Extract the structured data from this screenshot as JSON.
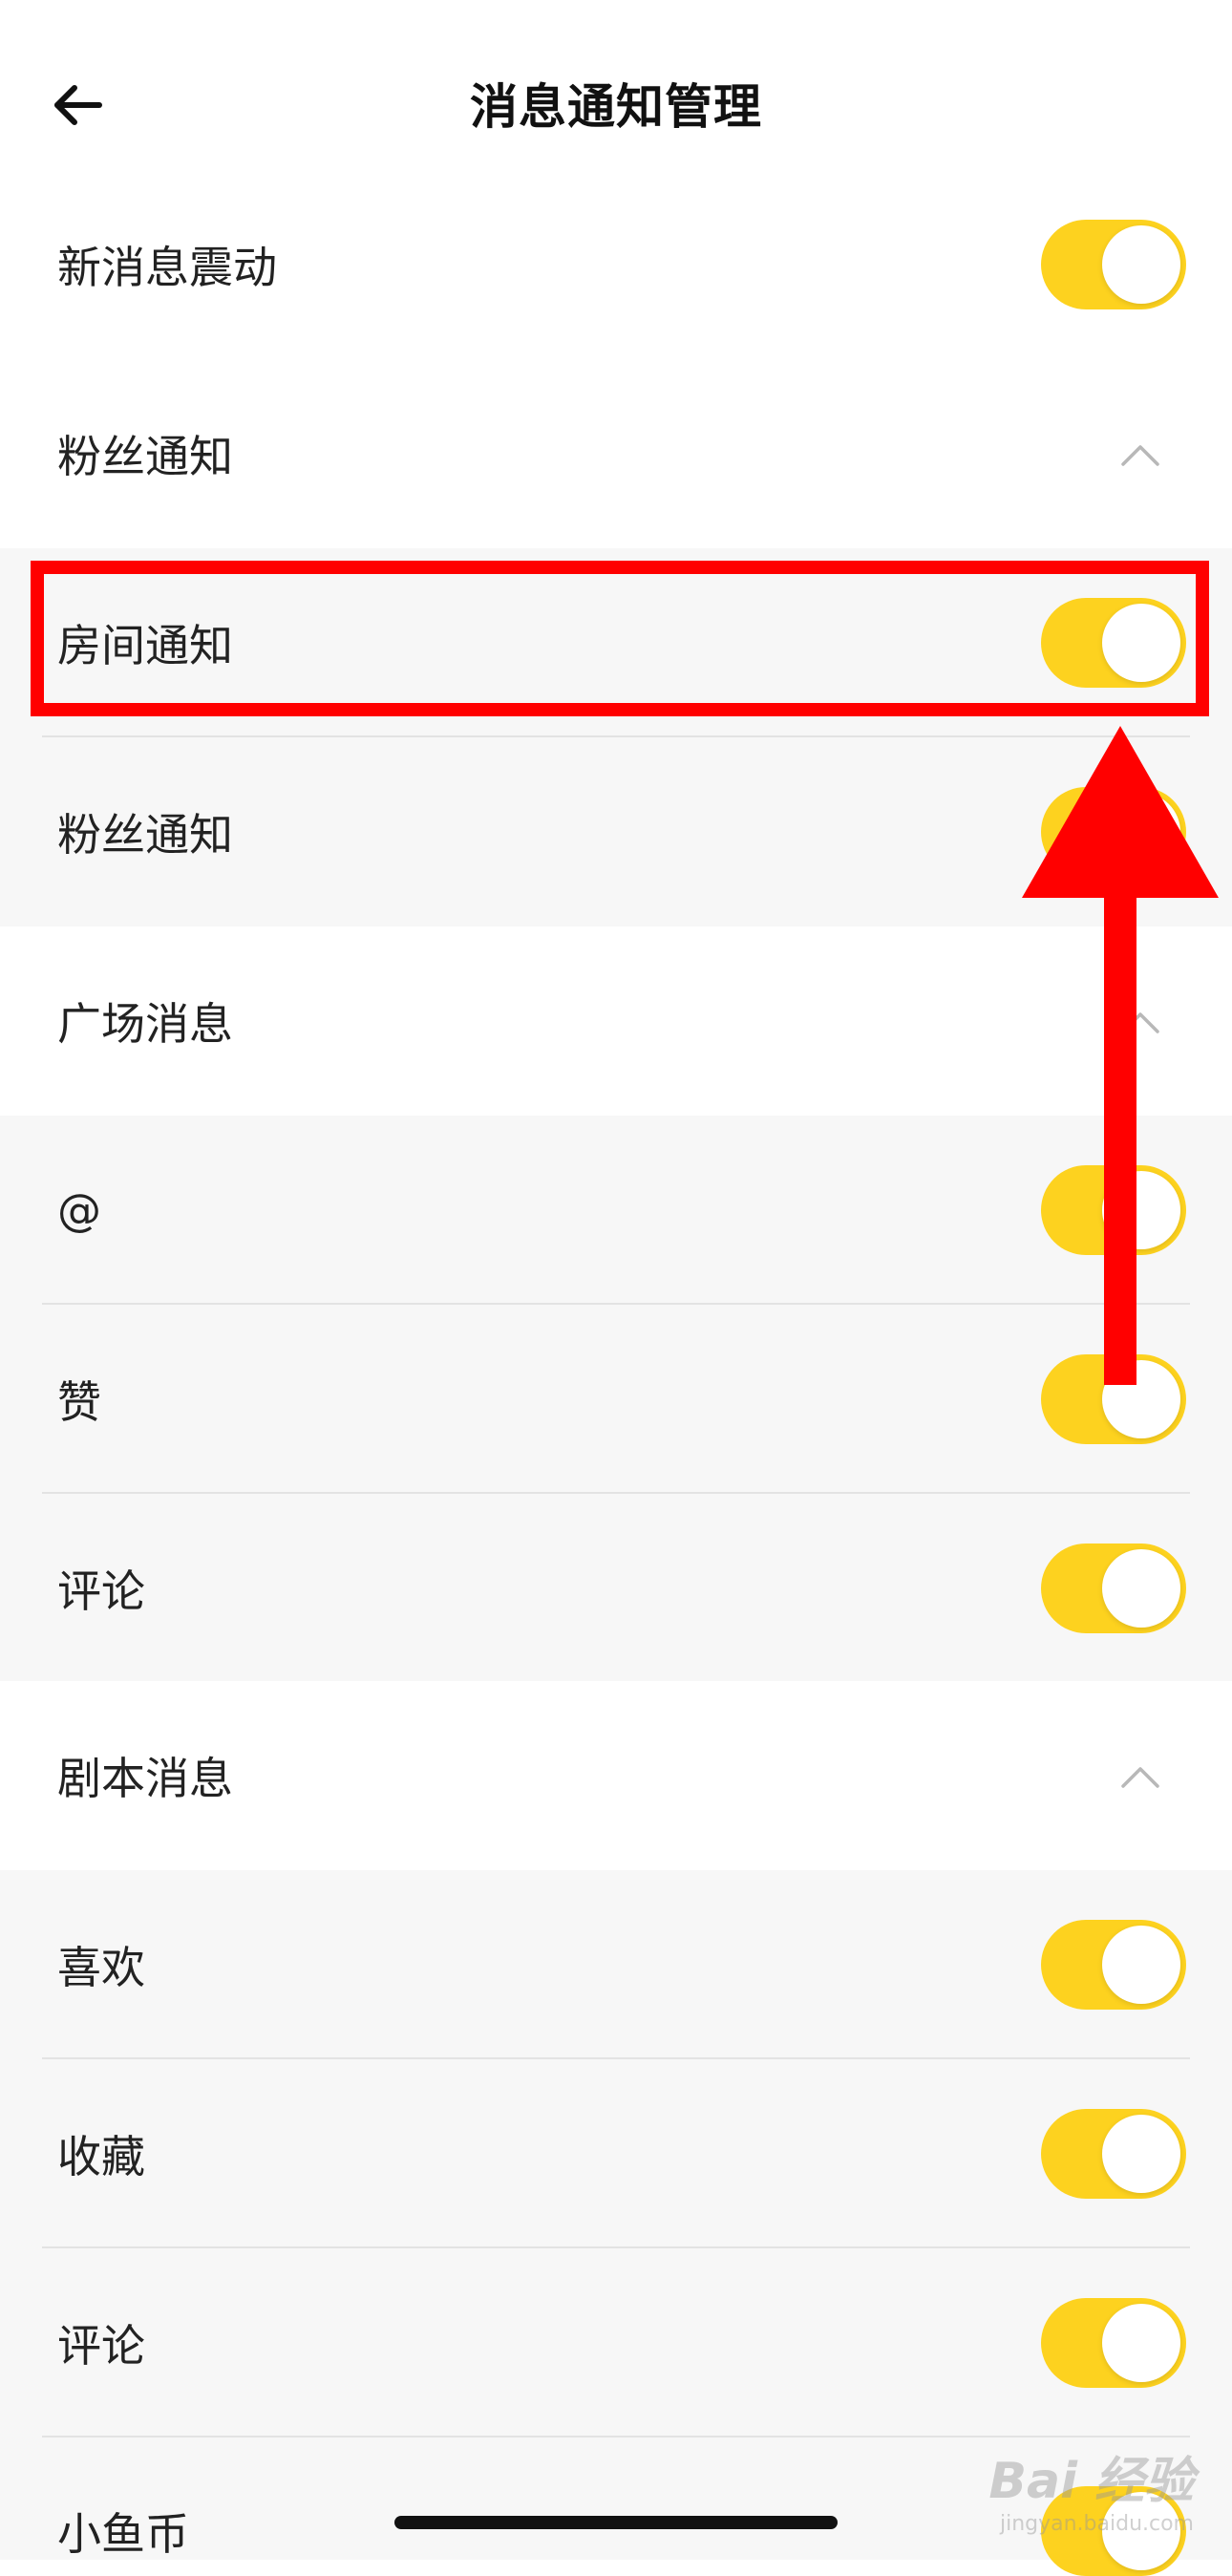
{
  "header": {
    "title": "消息通知管理",
    "back_icon": "back-arrow-icon"
  },
  "rows": {
    "vibrate": {
      "label": "新消息震动",
      "enabled": true
    },
    "fans_section": {
      "label": "粉丝通知",
      "expanded": true
    },
    "room_notice": {
      "label": "房间通知",
      "enabled": true
    },
    "fans_notice": {
      "label": "粉丝通知",
      "enabled": true
    },
    "square_section": {
      "label": "广场消息",
      "expanded": true
    },
    "at": {
      "label": "@",
      "enabled": true
    },
    "like": {
      "label": "赞",
      "enabled": true
    },
    "comment": {
      "label": "评论",
      "enabled": true
    },
    "script_section": {
      "label": "剧本消息",
      "expanded": true
    },
    "favor": {
      "label": "喜欢",
      "enabled": true
    },
    "collect": {
      "label": "收藏",
      "enabled": true
    },
    "script_comment": {
      "label": "评论",
      "enabled": true
    },
    "fish_coin": {
      "label": "小鱼币",
      "enabled": true
    }
  },
  "colors": {
    "toggle_on": "#fdd21f",
    "highlight": "#ff0000",
    "sub_row_bg": "#f7f7f7"
  },
  "watermark": {
    "brand": "Bai 经验",
    "url": "jingyan.baidu.com"
  }
}
